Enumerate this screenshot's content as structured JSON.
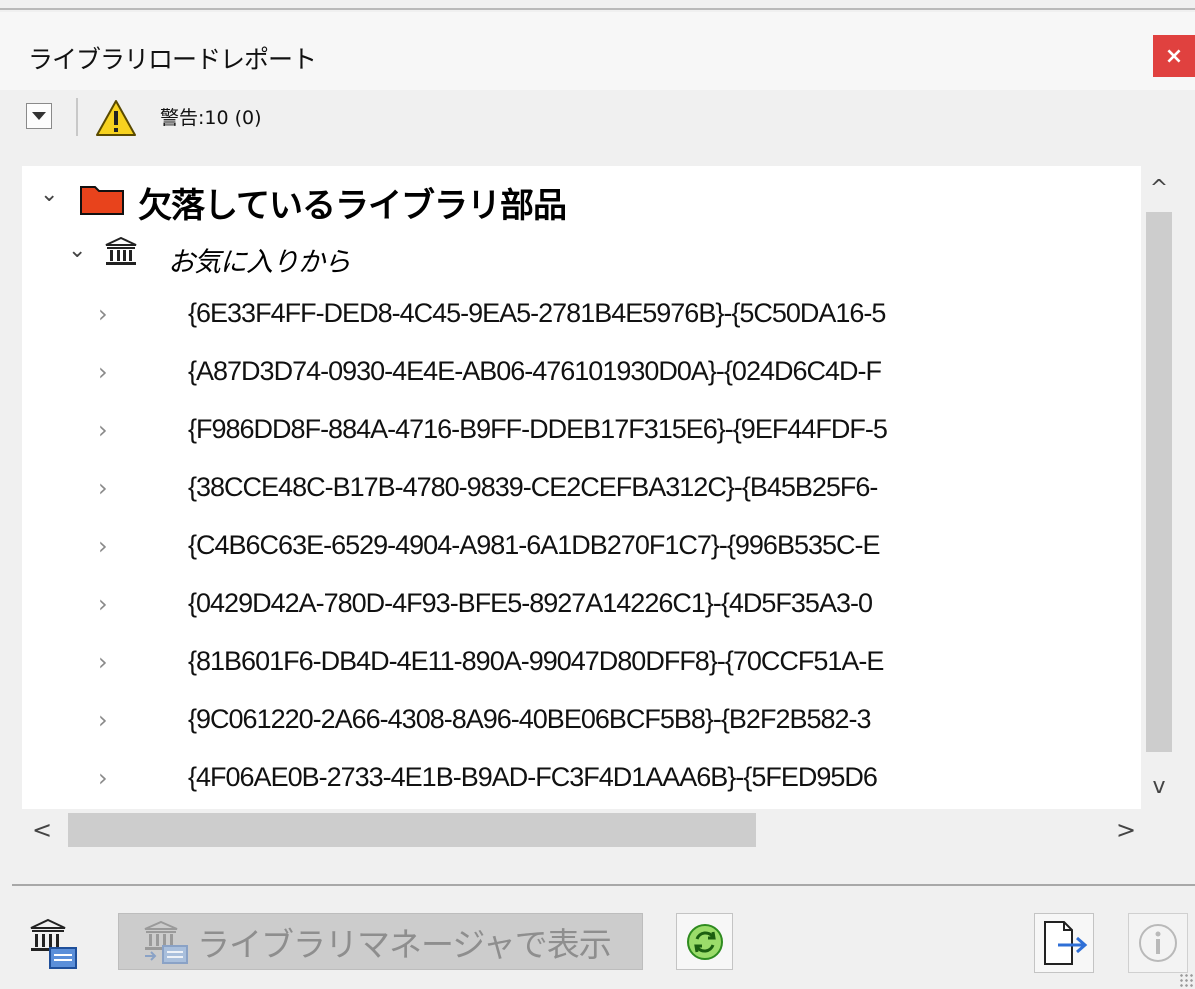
{
  "window": {
    "title": "ライブラリロードレポート",
    "close_label": "×"
  },
  "toolbar": {
    "dropdown_icon": "dropdown-triangle-icon",
    "warning_icon": "warning-triangle-icon",
    "warning_count": "警告:10 (0)"
  },
  "tree": {
    "category": {
      "label": "欠落しているライブラリ部品",
      "icon": "folder-icon",
      "folder_color": "#e8431c",
      "expanded": true
    },
    "subgroup": {
      "label": "お気に入りから",
      "icon": "library-building-icon",
      "expanded": true
    },
    "items": [
      {
        "text": "{6E33F4FF-DED8-4C45-9EA5-2781B4E5976B}-{5C50DA16-5"
      },
      {
        "text": "{A87D3D74-0930-4E4E-AB06-476101930D0A}-{024D6C4D-F"
      },
      {
        "text": "{F986DD8F-884A-4716-B9FF-DDEB17F315E6}-{9EF44FDF-5"
      },
      {
        "text": "{38CCE48C-B17B-4780-9839-CE2CEFBA312C}-{B45B25F6-"
      },
      {
        "text": "{C4B6C63E-6529-4904-A981-6A1DB270F1C7}-{996B535C-E"
      },
      {
        "text": "{0429D42A-780D-4F93-BFE5-8927A14226C1}-{4D5F35A3-0"
      },
      {
        "text": "{81B601F6-DB4D-4E11-890A-99047D80DFF8}-{70CCF51A-E"
      },
      {
        "text": "{9C061220-2A66-4308-8A96-40BE06BCF5B8}-{B2F2B582-3"
      },
      {
        "text": "{4F06AE0B-2733-4E1B-B9AD-FC3F4D1AAA6B}-{5FED95D6"
      }
    ]
  },
  "scrollbars": {
    "up": "^",
    "down": "v",
    "left": "<",
    "right": ">"
  },
  "footer": {
    "show_in_manager_label": "ライブラリマネージャで表示",
    "library_manager_icon": "library-manager-icon",
    "refresh_icon": "refresh-icon",
    "export_icon": "export-icon",
    "info_icon": "info-icon"
  }
}
